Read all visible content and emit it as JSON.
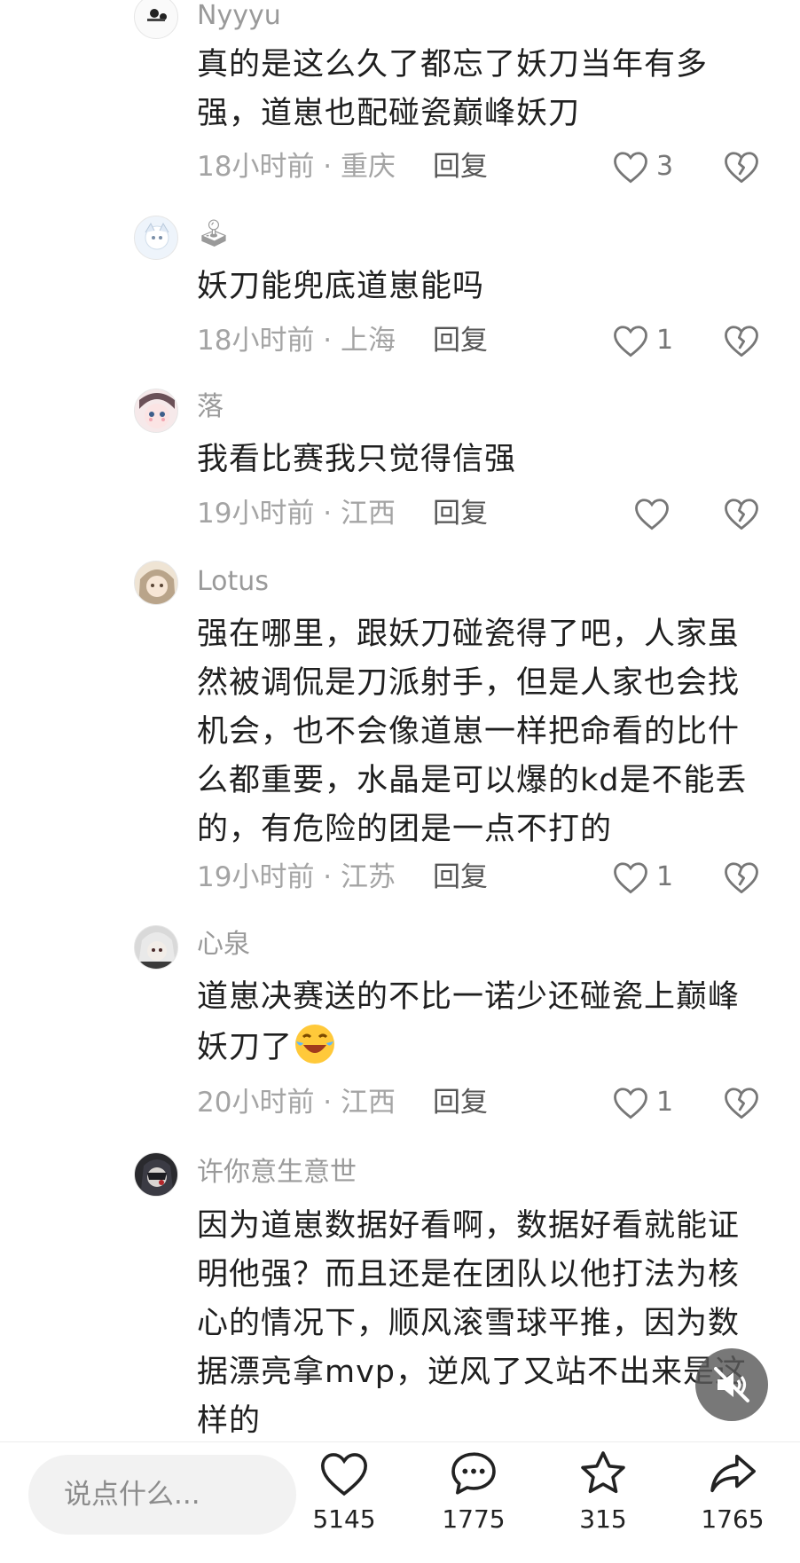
{
  "comments": [
    {
      "username": "Nyyyu",
      "text": "真的是这么久了都忘了妖刀当年有多强，道崽也配碰瓷巅峰妖刀",
      "meta": "18小时前 · 重庆",
      "reply": "回复",
      "likes": "3"
    },
    {
      "username": "🕹",
      "text": "妖刀能兜底道崽能吗",
      "meta": "18小时前 · 上海",
      "reply": "回复",
      "likes": "1"
    },
    {
      "username": "落",
      "text": "我看比赛我只觉得信强",
      "meta": "19小时前 · 江西",
      "reply": "回复",
      "likes": ""
    },
    {
      "username": "Lotus",
      "text": "强在哪里，跟妖刀碰瓷得了吧，人家虽然被调侃是刀派射手，但是人家也会找机会，也不会像道崽一样把命看的比什么都重要，水晶是可以爆的kd是不能丢的，有危险的团是一点不打的",
      "meta": "19小时前 · 江苏",
      "reply": "回复",
      "likes": "1"
    },
    {
      "username": "心泉",
      "text": "道崽决赛送的不比一诺少还碰瓷上巅峰妖刀了",
      "meta": "20小时前 · 江西",
      "reply": "回复",
      "likes": "1"
    },
    {
      "username": "许你意生意世",
      "text": "因为道崽数据好看啊，数据好看就能证明他强？而且还是在团队以他打法为核心的情况下，顺风滚雪球平推，因为数据漂亮拿mvp，逆风了又站不出来是这样的"
    }
  ],
  "bottom_bar": {
    "input_placeholder": "说点什么...",
    "like_count": "5145",
    "comment_count": "1775",
    "favorite_count": "315",
    "share_count": "1765"
  },
  "icons": {
    "like": "heart-outline-icon",
    "dislike": "broken-heart-icon",
    "comment": "chat-bubble-icon",
    "favorite": "star-icon",
    "share": "share-arrow-icon",
    "mute": "speaker-muted-icon"
  }
}
